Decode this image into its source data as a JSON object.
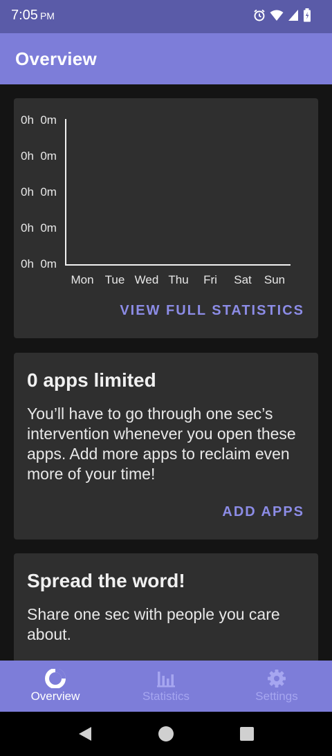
{
  "status_bar": {
    "time": "7:05",
    "ampm": "PM",
    "icons": [
      "alarm-icon",
      "wifi-icon",
      "cell-signal-icon",
      "battery-icon"
    ]
  },
  "app_bar": {
    "title": "Overview"
  },
  "chart_card": {
    "action_label": "VIEW FULL STATISTICS",
    "chart_data": {
      "type": "bar",
      "categories": [
        "Mon",
        "Tue",
        "Wed",
        "Thu",
        "Fri",
        "Sat",
        "Sun"
      ],
      "values": [
        0,
        0,
        0,
        0,
        0,
        0,
        0
      ],
      "y_tick_labels": [
        "0h  0m",
        "0h  0m",
        "0h  0m",
        "0h  0m",
        "0h  0m"
      ],
      "grid": false
    }
  },
  "limited_card": {
    "title": "0 apps limited",
    "body": "You’ll have to go through one sec’s intervention whenever you open these apps. Add more apps to reclaim even more of your time!",
    "action_label": "ADD APPS"
  },
  "spread_card": {
    "title": "Spread the word!",
    "body": "Share one sec with people you care about."
  },
  "bottom_nav": {
    "items": [
      {
        "label": "Overview",
        "icon": "donut-icon",
        "active": true
      },
      {
        "label": "Statistics",
        "icon": "bar-chart-icon",
        "active": false
      },
      {
        "label": "Settings",
        "icon": "gear-icon",
        "active": false
      }
    ]
  },
  "colors": {
    "accent": "#7d7dd9",
    "status_bar": "#5a5ba8",
    "action_text": "#8c8ce6",
    "card_bg": "#2f2f2f",
    "page_bg": "#141414"
  }
}
